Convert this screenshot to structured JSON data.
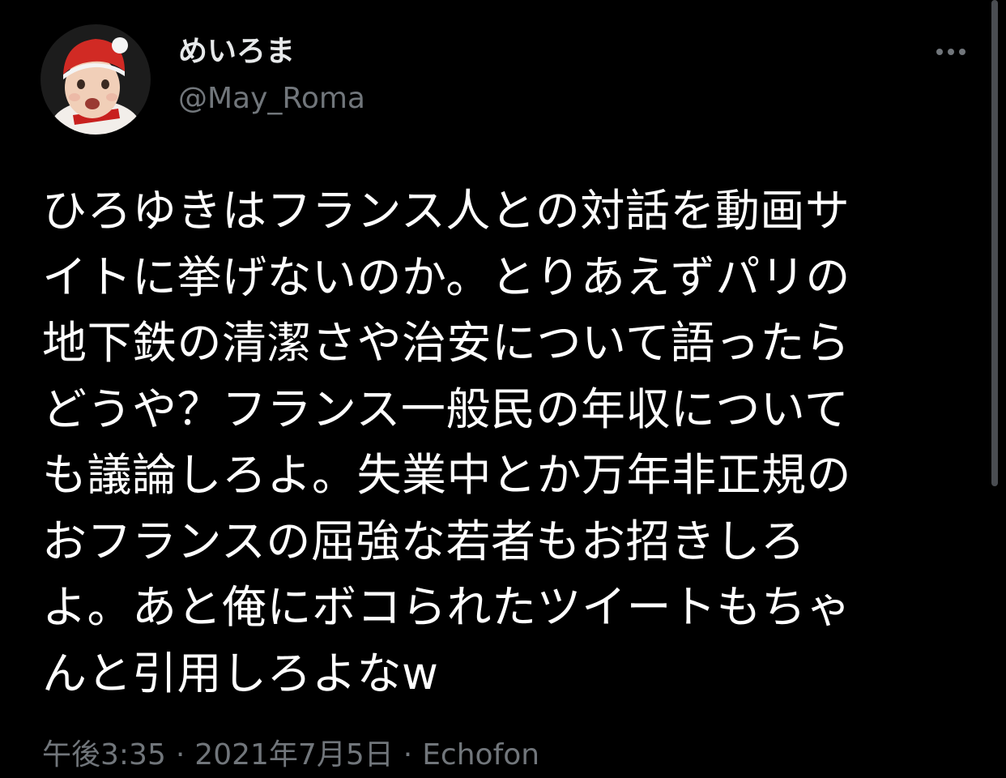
{
  "author": {
    "display_name": "めいろま",
    "handle": "@May_Roma",
    "avatar_icon": "profile-photo"
  },
  "menu": {
    "icon": "more-options-icon"
  },
  "tweet": {
    "lines": [
      "ひろゆきはフランス人との対話を動画サ",
      "イトに挙げないのか。とりあえずパリの",
      "地下鉄の清潔さや治安について語ったら",
      "どうや？フランス一般民の年収について",
      "も議論しろよ。失業中とか万年非正規の",
      "おフランスの屈強な若者もお招きしろ",
      "よ。あと俺にボコられたツイートもちゃ",
      "んと引用しろよなw"
    ]
  },
  "meta": {
    "time": "午後3:35",
    "separator": "·",
    "date": "2021年7月5日",
    "source": "Echofon"
  },
  "colors": {
    "background": "#000000",
    "text": "#ffffff",
    "secondary": "#71767b"
  }
}
